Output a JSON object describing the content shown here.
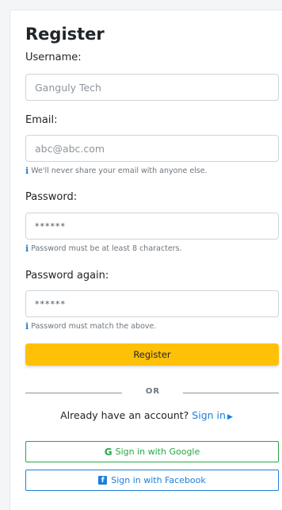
{
  "form": {
    "title": "Register",
    "username": {
      "label": "Username:",
      "placeholder": "Ganguly Tech"
    },
    "email": {
      "label": "Email:",
      "placeholder": "abc@abc.com",
      "hint": "We'll never share your email with anyone else."
    },
    "password": {
      "label": "Password:",
      "value": "******",
      "hint": "Password must be at least 8 characters."
    },
    "password_again": {
      "label": "Password again:",
      "value": "******",
      "hint": "Password must match the above."
    },
    "register_label": "Register"
  },
  "alt": {
    "or_text": "OR",
    "account_prompt": "Already have an account?",
    "signin_link": "Sign in"
  },
  "social": {
    "google_label": "Sign in with Google",
    "facebook_label": "Sign in with Facebook"
  },
  "colors": {
    "accent": "#ffc107",
    "link": "#1e7fd8",
    "google": "#28a745"
  }
}
